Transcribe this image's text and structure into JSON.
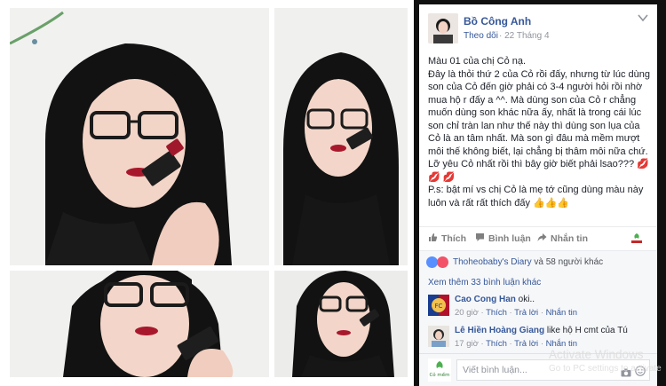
{
  "post": {
    "author": "Bồ Công Anh",
    "follow_label": "Theo dõi",
    "date": "· 22 Tháng 4",
    "lines": [
      "Màu 01 của chị Cỏ nạ.",
      "Đây là thỏi thứ 2 của Cỏ rồi đấy, nhưng từ lúc dùng",
      "son của Cỏ đến giờ phải có 3-4 người hỏi rồi nhờ",
      "mua hộ r đấy a ^^. Mà dùng son của Cỏ r chẳng",
      "muốn dùng son khác nữa ấy, nhất là trong cái lúc",
      "son chỉ tràn lan như thế này thì dùng son lụa của",
      "Cỏ là an tâm nhất. Mà son gì đâu mà mềm mượt",
      "môi thế không biết, lại chẳng bị thâm môi nữa chứ.",
      "Lỡ yêu Cỏ nhất rồi thì bây giờ biết phải lsao???"
    ],
    "emoji_kiss": "💋",
    "ps_line1": "P.s: bật mí vs chị Cỏ là mẹ tớ cũng dùng màu này",
    "ps_line2": "luôn và rất rất thích đấy",
    "emoji_hand": "👍👍👍"
  },
  "actions": {
    "like": "Thích",
    "comment": "Bình luận",
    "message": "Nhắn tin"
  },
  "reactions": {
    "names": "Thoheobaby's Diary",
    "rest": " và 58 người khác"
  },
  "comments": {
    "more": "Xem thêm 33 bình luận khác",
    "items": [
      {
        "name": "Cao Cong Han",
        "text": " oki..",
        "time": "20 giờ",
        "like": "Thích",
        "reply": "Trả lời",
        "msg": "Nhắn tin"
      },
      {
        "name": "Lê Hiền Hoàng Giang",
        "text": " like hộ H cmt của Tú",
        "time": "17 giờ",
        "like": "Thích",
        "reply": "Trả lời",
        "msg": "Nhắn tin"
      }
    ],
    "sep": "·"
  },
  "composer": {
    "placeholder": "Viết bình luận...",
    "brand_text": "Cỏ mềm"
  },
  "watermark": {
    "line1": "Activate Windows",
    "line2": "Go to PC settings to activate"
  },
  "colors": {
    "link": "#365899",
    "lipstick": "#a0182b",
    "panel_bg": "#f6f7f9"
  },
  "icons": [
    "like-icon",
    "comment-icon",
    "share-icon",
    "chevron-down-icon",
    "camera-icon",
    "smile-icon"
  ]
}
